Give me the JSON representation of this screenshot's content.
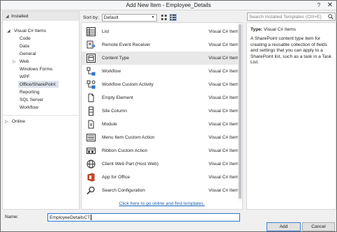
{
  "window": {
    "title": "Add New Item - Employee_Details"
  },
  "titlebar_buttons": {
    "help": "?",
    "close": "✕"
  },
  "left_nav": {
    "installed": "Installed",
    "visual_csharp": "Visual C# Items",
    "children": [
      "Code",
      "Data",
      "General",
      "Web",
      "Windows Forms",
      "WPF",
      "Office/SharePoint",
      "Reporting",
      "SQL Server",
      "Workflow"
    ],
    "selected": "Office/SharePoint",
    "online": "Online"
  },
  "sort": {
    "label": "Sort by:",
    "value": "Default"
  },
  "templates": [
    {
      "name": "List",
      "category": "Visual C# Items",
      "icon": "list-icon"
    },
    {
      "name": "Remote Event Receiver",
      "category": "Visual C# Items",
      "icon": "remote-event-receiver-icon"
    },
    {
      "name": "Content Type",
      "category": "Visual C# Items",
      "icon": "content-type-icon"
    },
    {
      "name": "Workflow",
      "category": "Visual C# Items",
      "icon": "workflow-icon"
    },
    {
      "name": "Workflow Custom Activity",
      "category": "Visual C# Items",
      "icon": "workflow-custom-activity-icon"
    },
    {
      "name": "Empty Element",
      "category": "Visual C# Items",
      "icon": "empty-element-icon"
    },
    {
      "name": "Site Column",
      "category": "Visual C# Items",
      "icon": "site-column-icon"
    },
    {
      "name": "Module",
      "category": "Visual C# Items",
      "icon": "module-icon"
    },
    {
      "name": "Menu Item Custom Action",
      "category": "Visual C# Items",
      "icon": "menu-item-icon"
    },
    {
      "name": "Ribbon Custom Action",
      "category": "Visual C# Items",
      "icon": "ribbon-icon"
    },
    {
      "name": "Client Web Part (Host Web)",
      "category": "Visual C# Items",
      "icon": "client-web-part-icon"
    },
    {
      "name": "App for Office",
      "category": "Visual C# Items",
      "icon": "app-for-office-icon"
    },
    {
      "name": "Search Configuration",
      "category": "Visual C# Items",
      "icon": "search-configuration-icon"
    }
  ],
  "selected_template": "Content Type",
  "online_link": "Click here to go online and find templates.",
  "search": {
    "placeholder": "Search Installed Templates (Ctrl+E)"
  },
  "details": {
    "type_label": "Type:",
    "type_value": "Visual C# Items",
    "description": "A SharePoint content type item for creating a reusable collection of fields and settings that you can apply to a SharePoint list, such as a task in a Task List."
  },
  "name_field": {
    "label": "Name:",
    "value": "EmployeeDetailsCT"
  },
  "buttons": {
    "add": "Add",
    "cancel": "Cancel"
  },
  "colors": {
    "accent": "#2b74d0",
    "selected_nav": "#dde2ec",
    "link": "#1a5fb4"
  }
}
